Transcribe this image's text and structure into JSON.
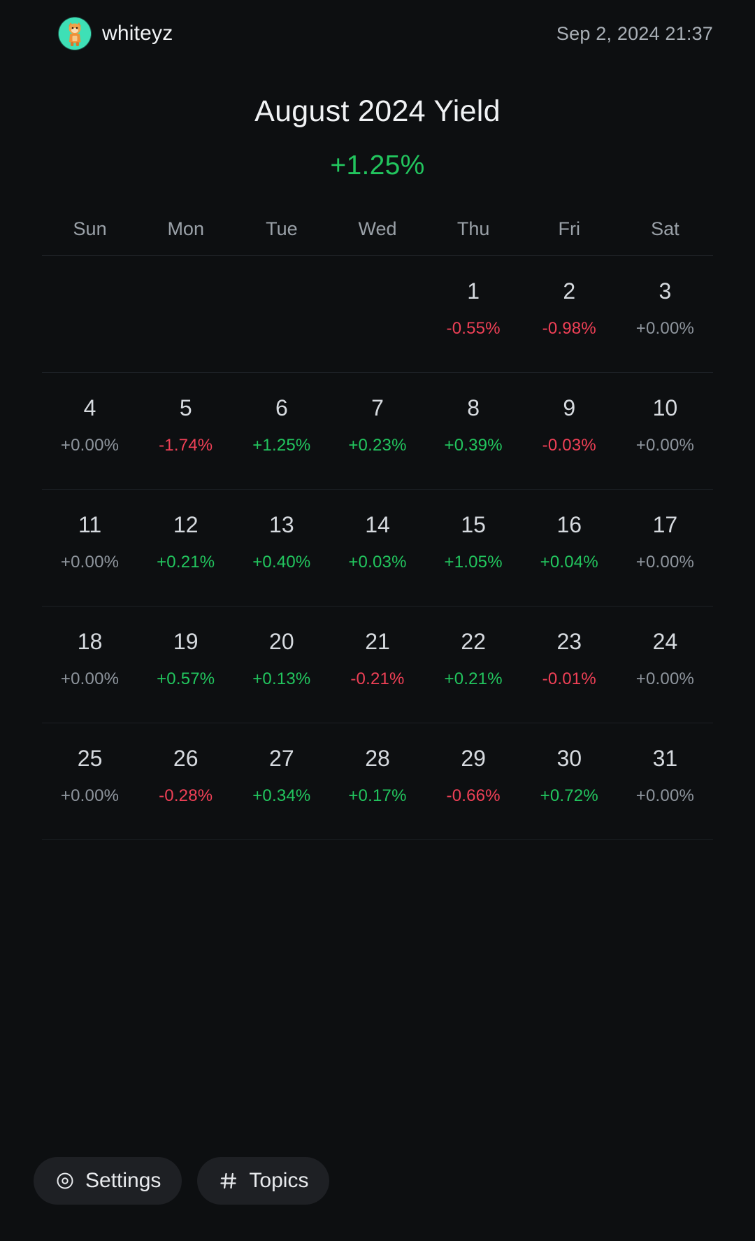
{
  "header": {
    "username": "whiteyz",
    "avatar_icon": "cat-avatar-icon",
    "timestamp": "Sep 2, 2024 21:37"
  },
  "summary": {
    "title": "August 2024 Yield",
    "total_yield": "+1.25%",
    "total_yield_color": "#22c55e"
  },
  "calendar": {
    "weekday_headers": [
      "Sun",
      "Mon",
      "Tue",
      "Wed",
      "Thu",
      "Fri",
      "Sat"
    ],
    "weeks": [
      [
        {
          "day": "",
          "pct": "",
          "sign": "empty"
        },
        {
          "day": "",
          "pct": "",
          "sign": "empty"
        },
        {
          "day": "",
          "pct": "",
          "sign": "empty"
        },
        {
          "day": "",
          "pct": "",
          "sign": "empty"
        },
        {
          "day": "1",
          "pct": "-0.55%",
          "sign": "neg"
        },
        {
          "day": "2",
          "pct": "-0.98%",
          "sign": "neg"
        },
        {
          "day": "3",
          "pct": "+0.00%",
          "sign": "zero"
        }
      ],
      [
        {
          "day": "4",
          "pct": "+0.00%",
          "sign": "zero"
        },
        {
          "day": "5",
          "pct": "-1.74%",
          "sign": "neg"
        },
        {
          "day": "6",
          "pct": "+1.25%",
          "sign": "pos"
        },
        {
          "day": "7",
          "pct": "+0.23%",
          "sign": "pos"
        },
        {
          "day": "8",
          "pct": "+0.39%",
          "sign": "pos"
        },
        {
          "day": "9",
          "pct": "-0.03%",
          "sign": "neg"
        },
        {
          "day": "10",
          "pct": "+0.00%",
          "sign": "zero"
        }
      ],
      [
        {
          "day": "11",
          "pct": "+0.00%",
          "sign": "zero"
        },
        {
          "day": "12",
          "pct": "+0.21%",
          "sign": "pos"
        },
        {
          "day": "13",
          "pct": "+0.40%",
          "sign": "pos"
        },
        {
          "day": "14",
          "pct": "+0.03%",
          "sign": "pos"
        },
        {
          "day": "15",
          "pct": "+1.05%",
          "sign": "pos"
        },
        {
          "day": "16",
          "pct": "+0.04%",
          "sign": "pos"
        },
        {
          "day": "17",
          "pct": "+0.00%",
          "sign": "zero"
        }
      ],
      [
        {
          "day": "18",
          "pct": "+0.00%",
          "sign": "zero"
        },
        {
          "day": "19",
          "pct": "+0.57%",
          "sign": "pos"
        },
        {
          "day": "20",
          "pct": "+0.13%",
          "sign": "pos"
        },
        {
          "day": "21",
          "pct": "-0.21%",
          "sign": "neg"
        },
        {
          "day": "22",
          "pct": "+0.21%",
          "sign": "pos"
        },
        {
          "day": "23",
          "pct": "-0.01%",
          "sign": "neg"
        },
        {
          "day": "24",
          "pct": "+0.00%",
          "sign": "zero"
        }
      ],
      [
        {
          "day": "25",
          "pct": "+0.00%",
          "sign": "zero"
        },
        {
          "day": "26",
          "pct": "-0.28%",
          "sign": "neg"
        },
        {
          "day": "27",
          "pct": "+0.34%",
          "sign": "pos"
        },
        {
          "day": "28",
          "pct": "+0.17%",
          "sign": "pos"
        },
        {
          "day": "29",
          "pct": "-0.66%",
          "sign": "neg"
        },
        {
          "day": "30",
          "pct": "+0.72%",
          "sign": "pos"
        },
        {
          "day": "31",
          "pct": "+0.00%",
          "sign": "zero"
        }
      ]
    ]
  },
  "bottom_bar": {
    "settings_label": "Settings",
    "settings_icon": "gear-icon",
    "topics_label": "Topics",
    "topics_icon": "hash-icon"
  },
  "colors": {
    "background": "#0d0f11",
    "positive": "#22c55e",
    "negative": "#ef4056",
    "neutral": "#8e959d",
    "accent_avatar": "#3ee0b6"
  }
}
